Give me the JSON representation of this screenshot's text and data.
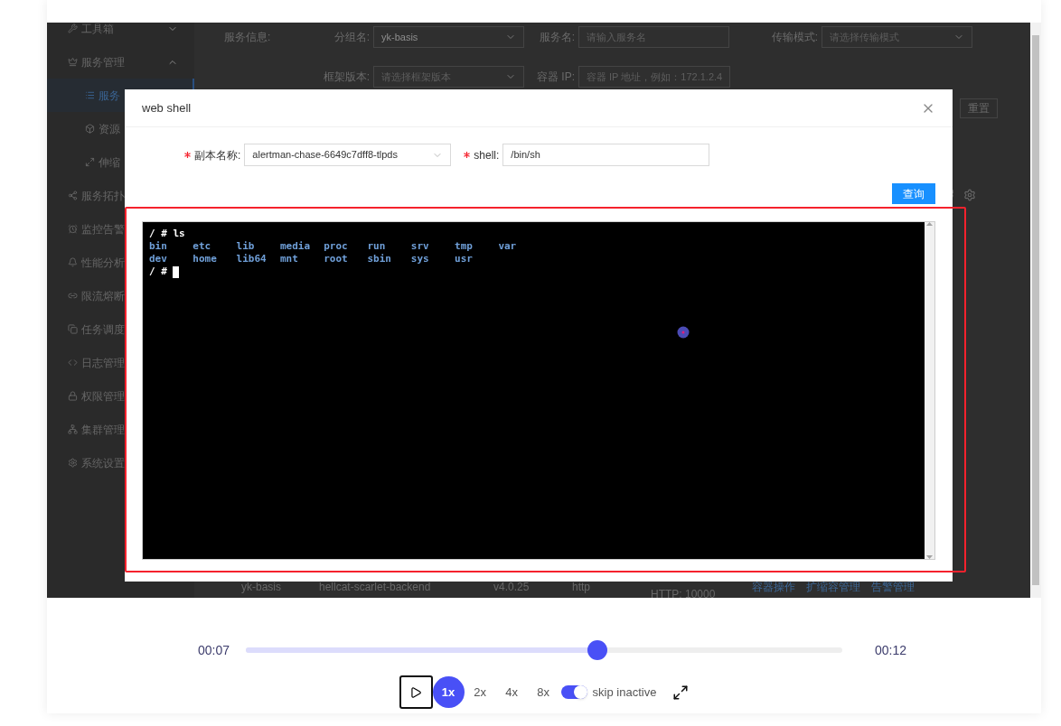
{
  "sidebar": {
    "items": [
      {
        "label": "工具箱",
        "expanded": false,
        "selected": false
      },
      {
        "label": "服务管理",
        "expanded": true,
        "selected": false,
        "children": [
          {
            "label": "服务",
            "selected": true
          },
          {
            "label": "资源",
            "selected": false
          },
          {
            "label": "伸缩",
            "selected": false
          }
        ]
      },
      {
        "label": "服务拓扑",
        "selected": false
      },
      {
        "label": "监控告警",
        "selected": false
      },
      {
        "label": "性能分析",
        "selected": false
      },
      {
        "label": "限流熔断",
        "selected": false
      },
      {
        "label": "任务调度",
        "selected": false
      },
      {
        "label": "日志管理",
        "selected": false
      },
      {
        "label": "权限管理",
        "selected": false
      },
      {
        "label": "集群管理",
        "selected": false
      },
      {
        "label": "系统设置",
        "selected": false
      }
    ]
  },
  "filters": {
    "section_label": "服务信息:",
    "rows": [
      [
        {
          "label": "分组名:",
          "kind": "select",
          "value": "yk-basis"
        },
        {
          "label": "服务名:",
          "kind": "input",
          "placeholder": "请输入服务名"
        },
        {
          "label": "传输模式:",
          "kind": "select",
          "placeholder": "请选择传输模式"
        }
      ],
      [
        {
          "label": "框架版本:",
          "kind": "select",
          "placeholder": "请选择框架版本"
        },
        {
          "label": "容器 IP:",
          "kind": "input",
          "placeholder": "容器 IP 地址，例如：172.1.2.4"
        }
      ]
    ],
    "reset_button": "重置"
  },
  "table": {
    "row": {
      "cells": [
        "yk-basis",
        "hellcat-scarlet-backend",
        "v4.0.25",
        "http",
        "HTTP: 10000"
      ],
      "actions": [
        "容器操作",
        "扩缩容管理",
        "告警管理"
      ]
    }
  },
  "modal": {
    "title": "web shell",
    "fields": [
      {
        "label": "副本名称:",
        "required": true,
        "kind": "select",
        "value": "alertman-chase-6649c7dff8-tlpds"
      },
      {
        "label": "shell:",
        "required": true,
        "kind": "input",
        "value": "/bin/sh"
      }
    ],
    "query_button": "查询",
    "terminal": {
      "lines": [
        {
          "kind": "output",
          "text": "/ # ls"
        },
        {
          "kind": "listing",
          "items": [
            "bin",
            "etc",
            "lib",
            "media",
            "proc",
            "run",
            "srv",
            "tmp",
            "var"
          ]
        },
        {
          "kind": "listing",
          "items": [
            "dev",
            "home",
            "lib64",
            "mnt",
            "root",
            "sbin",
            "sys",
            "usr"
          ]
        },
        {
          "kind": "input",
          "text": "/ #"
        }
      ]
    }
  },
  "player": {
    "current_time": "00:07",
    "total_time": "00:12",
    "level": 0.59,
    "speeds": [
      {
        "label": "1x",
        "selected": true
      },
      {
        "label": "2x",
        "selected": false
      },
      {
        "label": "4x",
        "selected": false
      },
      {
        "label": "8x",
        "selected": false
      }
    ],
    "skip_inactive": {
      "label": "skip inactive",
      "on": true
    }
  }
}
